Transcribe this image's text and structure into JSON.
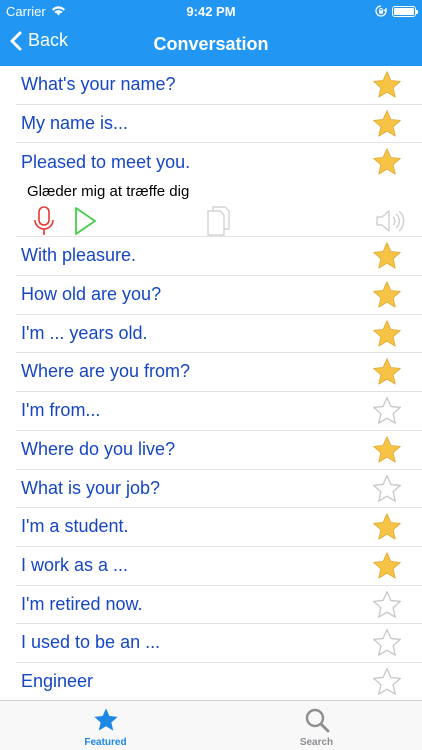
{
  "status": {
    "carrier": "Carrier",
    "time": "9:42 PM"
  },
  "nav": {
    "back_label": "Back",
    "title": "Conversation"
  },
  "expanded": {
    "phrase": "Pleased to meet you.",
    "translation": "Glæder mig at træffe dig",
    "starred": true
  },
  "phrases": [
    {
      "text": "What's your name?",
      "starred": true
    },
    {
      "text": "My name is...",
      "starred": true
    },
    {
      "text": "With pleasure.",
      "starred": true
    },
    {
      "text": "How old are you?",
      "starred": true
    },
    {
      "text": "I'm ... years old.",
      "starred": true
    },
    {
      "text": "Where are you from?",
      "starred": true
    },
    {
      "text": "I'm from...",
      "starred": false
    },
    {
      "text": "Where do you live?",
      "starred": true
    },
    {
      "text": "What is your job?",
      "starred": false
    },
    {
      "text": "I'm a student.",
      "starred": true
    },
    {
      "text": "I work as a ...",
      "starred": true
    },
    {
      "text": "I'm retired now.",
      "starred": false
    },
    {
      "text": "I used to be an ...",
      "starred": false
    },
    {
      "text": "Engineer",
      "starred": false
    }
  ],
  "tabs": [
    {
      "label": "Featured",
      "icon": "star-icon",
      "active": true
    },
    {
      "label": "Search",
      "icon": "search-icon",
      "active": false
    }
  ],
  "colors": {
    "nav_bar": "#2196f3",
    "phrase_text": "#1546c4",
    "star_fill": "#f6c344",
    "star_outline": "#c8c8c8",
    "mic": "#e53935",
    "play": "#43d04a",
    "tab_active": "#1e88e5",
    "tab_inactive": "#8e8e93"
  }
}
